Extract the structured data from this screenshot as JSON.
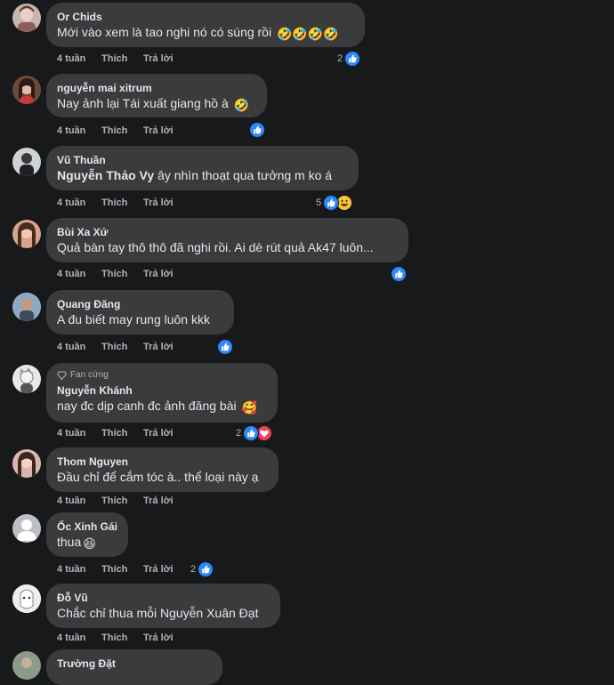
{
  "time_label": "4 tuần",
  "like_label": "Thích",
  "reply_label": "Trả lời",
  "fan_badge": "Fan cứng",
  "comments": [
    {
      "name": "Or Chids",
      "text": "Mới vào xem là tao nghi nó có súng rồi",
      "emoji": "🤣🤣🤣🤣",
      "reaction_count": "2"
    },
    {
      "name": "nguyễn mai xitrum",
      "text": "Nay ảnh lại Tái xuất giang hồ à",
      "emoji": "🤣",
      "reaction_count": ""
    },
    {
      "name": "Vũ Thuần",
      "mention": "Nguyễn Thảo Vy",
      "text": " ây nhìn thoạt qua tưởng m ko á",
      "reaction_count": "5"
    },
    {
      "name": "Bùi Xa Xứ",
      "text": "Quả bàn tay thô thô đã nghi rồi. Ai dè rút quả Ak47 luôn...",
      "reaction_count": ""
    },
    {
      "name": "Quang Đăng",
      "text": "A đu biết may rung luôn kkk",
      "reaction_count": ""
    },
    {
      "name": "Nguyễn Khánh",
      "text": "nay đc dịp canh đc ảnh đăng bài",
      "emoji": "🥰",
      "reaction_count": "2"
    },
    {
      "name": "Thom Nguyen",
      "text": "Đầu chỉ để cắm tóc à.. thể loại này ạ",
      "reaction_count": ""
    },
    {
      "name": "Ốc Xinh Gái",
      "text": "thua",
      "emoji": "😆",
      "reaction_count": "2"
    },
    {
      "name": "Đỗ Vũ",
      "text": "Chắc chỉ thua mỗi Nguyễn Xuân Đạt",
      "reaction_count": ""
    },
    {
      "name": "Trường Đặt",
      "text": "",
      "reaction_count": ""
    }
  ],
  "colors": {
    "background": "#18191a",
    "bubble": "#3a3b3c",
    "like_blue": "#2d88ff",
    "love_red": "#f33e58",
    "meta_gray": "#b0b3b8"
  }
}
